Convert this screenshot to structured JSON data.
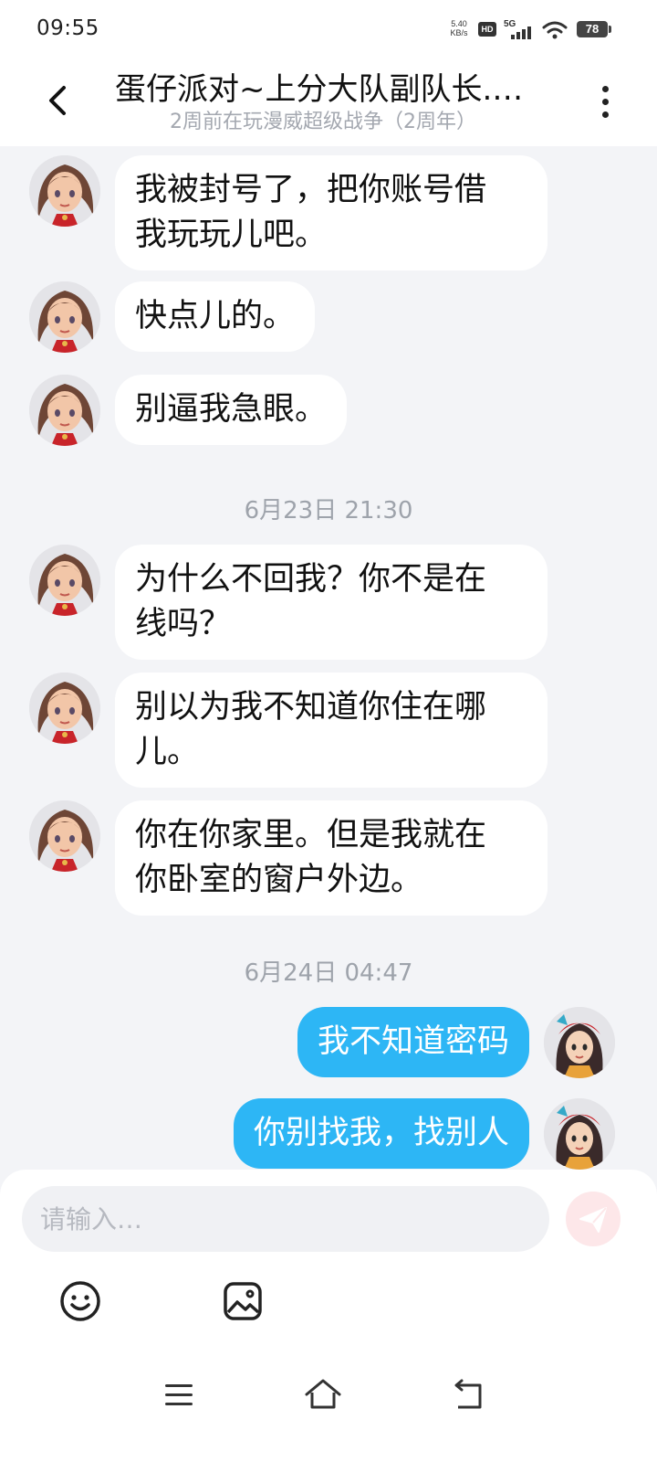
{
  "status_bar": {
    "time": "09:55",
    "net_speed_value": "5.40",
    "net_speed_unit": "KB/s",
    "hd_badge": "HD",
    "network": "5G",
    "battery": "78"
  },
  "header": {
    "title": "蛋仔派对~上分大队副队长.…",
    "subtitle": "2周前在玩漫威超级战争（2周年）"
  },
  "messages": [
    {
      "side": "left",
      "text": "我被封号了，把你账号借\n我玩玩儿吧。"
    },
    {
      "side": "left",
      "text": "快点儿的。"
    },
    {
      "side": "left",
      "text": "别逼我急眼。"
    },
    {
      "type": "timestamp",
      "text": "6月23日 21:30"
    },
    {
      "side": "left",
      "text": "为什么不回我？你不是在\n线吗？"
    },
    {
      "side": "left",
      "text": "别以为我不知道你住在哪\n儿。"
    },
    {
      "side": "left",
      "text": "你在你家里。但是我就在\n你卧室的窗户外边。"
    },
    {
      "type": "timestamp",
      "text": "6月24日 04:47"
    },
    {
      "side": "right",
      "text": "我不知道密码"
    },
    {
      "side": "right",
      "text": "你别找我，找别人"
    }
  ],
  "composer": {
    "placeholder": "请输入…"
  },
  "colors": {
    "accent_blue": "#2db6f5",
    "send_button_bg": "#fde7e9",
    "background": "#f3f4f7"
  },
  "icons": [
    "back-icon",
    "more-icon",
    "send-icon",
    "emoji-icon",
    "image-icon",
    "menu-icon",
    "home-icon",
    "nav-back-icon"
  ]
}
